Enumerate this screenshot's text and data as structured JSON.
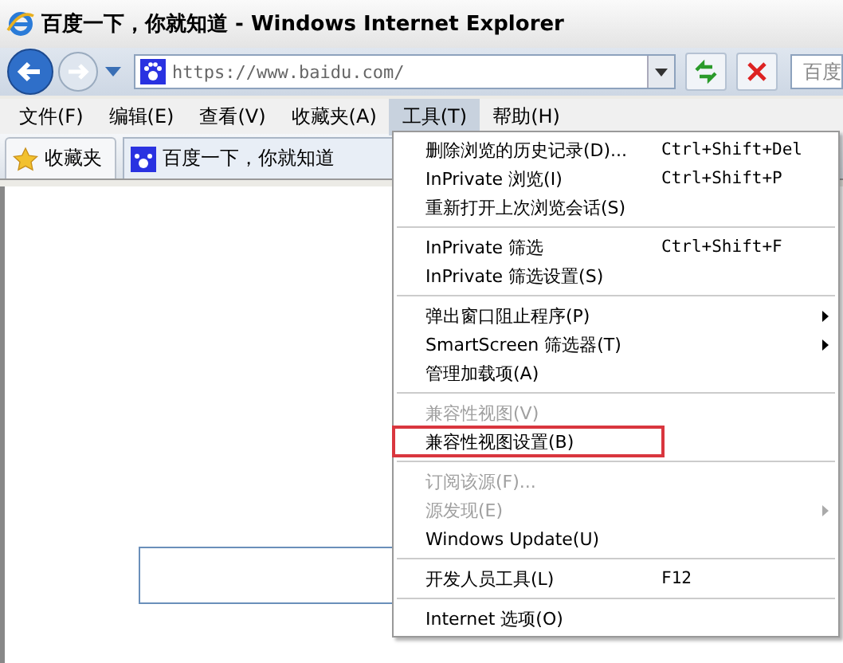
{
  "window": {
    "title": "百度一下，你就知道 - Windows Internet Explorer"
  },
  "address_bar": {
    "url": "https://www.baidu.com/",
    "search_text": "百度"
  },
  "menu_bar": [
    {
      "label": "文件(F)",
      "selected": false
    },
    {
      "label": "编辑(E)",
      "selected": false
    },
    {
      "label": "查看(V)",
      "selected": false
    },
    {
      "label": "收藏夹(A)",
      "selected": false
    },
    {
      "label": "工具(T)",
      "selected": true
    },
    {
      "label": "帮助(H)",
      "selected": false
    }
  ],
  "favorites_bar": {
    "favorites_label": "收藏夹",
    "tab_title": "百度一下，你就知道"
  },
  "tools_menu": [
    {
      "kind": "item",
      "label": "删除浏览的历史记录(D)...",
      "shortcut": "Ctrl+Shift+Del",
      "disabled": false,
      "submenu": false,
      "highlighted": false
    },
    {
      "kind": "item",
      "label": "InPrivate 浏览(I)",
      "shortcut": "Ctrl+Shift+P",
      "disabled": false,
      "submenu": false,
      "highlighted": false
    },
    {
      "kind": "item",
      "label": "重新打开上次浏览会话(S)",
      "disabled": false,
      "submenu": false,
      "highlighted": false
    },
    {
      "kind": "separator"
    },
    {
      "kind": "item",
      "label": "InPrivate 筛选",
      "shortcut": "Ctrl+Shift+F",
      "disabled": false,
      "submenu": false,
      "highlighted": false
    },
    {
      "kind": "item",
      "label": "InPrivate 筛选设置(S)",
      "disabled": false,
      "submenu": false,
      "highlighted": false
    },
    {
      "kind": "separator"
    },
    {
      "kind": "item",
      "label": "弹出窗口阻止程序(P)",
      "disabled": false,
      "submenu": true,
      "highlighted": false
    },
    {
      "kind": "item",
      "label": "SmartScreen 筛选器(T)",
      "disabled": false,
      "submenu": true,
      "highlighted": false
    },
    {
      "kind": "item",
      "label": "管理加载项(A)",
      "disabled": false,
      "submenu": false,
      "highlighted": false
    },
    {
      "kind": "separator"
    },
    {
      "kind": "item",
      "label": "兼容性视图(V)",
      "disabled": true,
      "submenu": false,
      "highlighted": false
    },
    {
      "kind": "item",
      "label": "兼容性视图设置(B)",
      "disabled": false,
      "submenu": false,
      "highlighted": true
    },
    {
      "kind": "separator"
    },
    {
      "kind": "item",
      "label": "订阅该源(F)...",
      "disabled": true,
      "submenu": false,
      "highlighted": false
    },
    {
      "kind": "item",
      "label": "源发现(E)",
      "disabled": true,
      "submenu": true,
      "highlighted": false
    },
    {
      "kind": "item",
      "label": "Windows Update(U)",
      "disabled": false,
      "submenu": false,
      "highlighted": false
    },
    {
      "kind": "separator"
    },
    {
      "kind": "item",
      "label": "开发人员工具(L)",
      "shortcut": "F12",
      "disabled": false,
      "submenu": false,
      "highlighted": false
    },
    {
      "kind": "separator"
    },
    {
      "kind": "item",
      "label": "Internet 选项(O)",
      "disabled": false,
      "submenu": false,
      "highlighted": false
    }
  ]
}
